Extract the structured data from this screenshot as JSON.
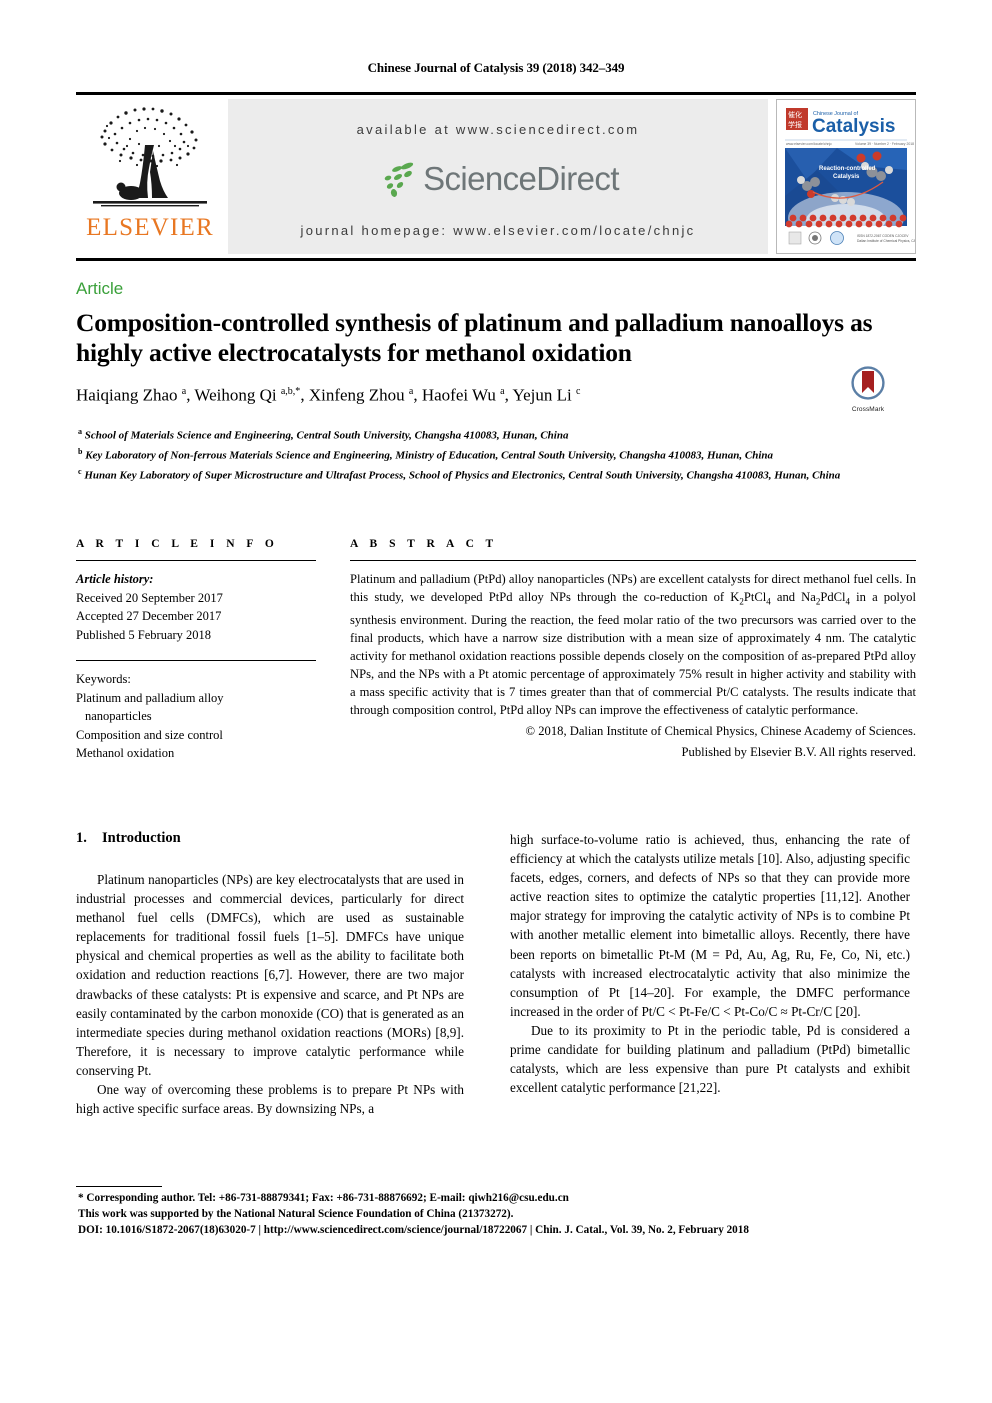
{
  "running_head": "Chinese Journal of Catalysis 39 (2018) 342–349",
  "masthead": {
    "publisher": "ELSEVIER",
    "available_at": "available at www.sciencedirect.com",
    "sciencedirect_logo_text": "ScienceDirect",
    "journal_homepage": "journal homepage: www.elsevier.com/locate/chnjc",
    "cover": {
      "journal_kicker": "Chinese Journal of",
      "journal_name": "Catalysis",
      "cover_caption": "Reaction-controlled Catalysis",
      "cover_volume_line": "Volume 39 · Number 2 · February 2018"
    },
    "colors": {
      "elsevier_orange": "#E87722",
      "sd_band": "#ececec",
      "sd_gray": "#6e7678",
      "sd_green": "#5aa84f",
      "catalysis_blue": "#1b5fa8"
    }
  },
  "article_type": "Article",
  "title": "Composition-controlled synthesis of platinum and palladium nanoalloys as highly active electrocatalysts for methanol oxidation",
  "authors": [
    {
      "name": "Haiqiang Zhao",
      "marks": "a",
      "sep": ", "
    },
    {
      "name": "Weihong Qi",
      "marks": "a,b,*",
      "sep": ", "
    },
    {
      "name": "Xinfeng Zhou",
      "marks": "a",
      "sep": ", "
    },
    {
      "name": "Haofei Wu",
      "marks": "a",
      "sep": ", "
    },
    {
      "name": "Yejun Li",
      "marks": "c",
      "sep": ""
    }
  ],
  "crossmark": {
    "label": "CrossMark",
    "accent": "#a51f1f"
  },
  "affiliations": [
    {
      "mark": "a",
      "text": "School of Materials Science and Engineering, Central South University, Changsha 410083, Hunan, China"
    },
    {
      "mark": "b",
      "text": "Key Laboratory of Non-ferrous Materials Science and Engineering, Ministry of Education, Central South University, Changsha 410083, Hunan, China"
    },
    {
      "mark": "c",
      "text": "Hunan Key Laboratory of Super Microstructure and Ultrafast Process, School of Physics and Electronics, Central South University, Changsha 410083, Hunan, China"
    }
  ],
  "article_info": {
    "heading": "A R T I C L E    I N F O",
    "history_label": "Article history:",
    "history": [
      "Received 20 September 2017",
      "Accepted 27 December 2017",
      "Published 5 February 2018"
    ],
    "keywords_label": "Keywords:",
    "keywords": [
      "Platinum and palladium alloy",
      "nanoparticles",
      "Composition and size control",
      "Methanol oxidation"
    ]
  },
  "abstract": {
    "heading": "A B S T R A C T",
    "part1": "Platinum and palladium (PtPd) alloy nanoparticles (NPs) are excellent catalysts for direct methanol fuel cells. In this study, we developed PtPd alloy NPs through the co-reduction of K",
    "sub1": "2",
    "part2": "PtCl",
    "sub2": "4",
    "part3": " and Na",
    "sub3": "2",
    "part4": "PdCl",
    "sub4": "4",
    "part5": " in a polyol synthesis environment. During the reaction, the feed molar ratio of the two precursors was carried over to the final products, which have a narrow size distribution with a mean size of approximately 4 nm. The catalytic activity for methanol oxidation reactions possible depends closely on the composition of as-prepared PtPd alloy NPs, and the NPs with a Pt atomic percentage of approximately 75% result in higher activity and stability with a mass specific activity that is 7 times greater than that of commercial Pt/C catalysts. The results indicate that through composition control, PtPd alloy NPs can improve the effectiveness of catalytic performance.",
    "copyright_line1": "© 2018, Dalian Institute of Chemical Physics, Chinese Academy of Sciences.",
    "copyright_line2": "Published by Elsevier B.V. All rights reserved."
  },
  "body": {
    "section_number": "1.",
    "section_title": "Introduction",
    "left_paragraphs": [
      "Platinum nanoparticles (NPs) are key electrocatalysts that are used in industrial processes and commercial devices, particularly for direct methanol fuel cells (DMFCs), which are used as sustainable replacements for traditional fossil fuels [1–5]. DMFCs have unique physical and chemical properties as well as the ability to facilitate both oxidation and reduction reactions [6,7]. However, there are two major drawbacks of these catalysts: Pt is expensive and scarce, and Pt NPs are easily contaminated by the carbon monoxide (CO) that is generated as an intermediate species during methanol oxidation reactions (MORs) [8,9]. Therefore, it is necessary to improve catalytic performance while conserving Pt.",
      "One way of overcoming these problems is to prepare Pt NPs with high active specific surface areas. By downsizing NPs, a"
    ],
    "right_paragraphs": [
      "high surface-to-volume ratio is achieved, thus, enhancing the rate of efficiency at which the catalysts utilize metals [10]. Also, adjusting specific facets, edges, corners, and defects of NPs so that they can provide more active reaction sites to optimize the catalytic properties [11,12]. Another major strategy for improving the catalytic activity of NPs is to combine Pt with another metallic element into bimetallic alloys. Recently, there have been reports on bimetallic Pt-M (M = Pd, Au, Ag, Ru, Fe, Co, Ni, etc.) catalysts with increased electrocatalytic activity that also minimize the consumption of Pt [14–20]. For example, the DMFC performance increased in the order of Pt/C < Pt-Fe/C < Pt-Co/C ≈ Pt-Cr/C [20].",
      "Due to its proximity to Pt in the periodic table, Pd is considered a prime candidate for building platinum and palladium (PtPd) bimetallic catalysts, which are less expensive than pure Pt catalysts and exhibit excellent catalytic performance [21,22]."
    ]
  },
  "footnotes": {
    "corresponding": "* Corresponding author. Tel: +86-731-88879341; Fax: +86-731-88876692; E-mail: qiwh216@csu.edu.cn",
    "funding": "This work was supported by the National Natural Science Foundation of China (21373272).",
    "doi_line": "DOI: 10.1016/S1872-2067(18)63020-7 | http://www.sciencedirect.com/science/journal/18722067 | Chin. J. Catal., Vol. 39, No. 2, February 2018"
  }
}
